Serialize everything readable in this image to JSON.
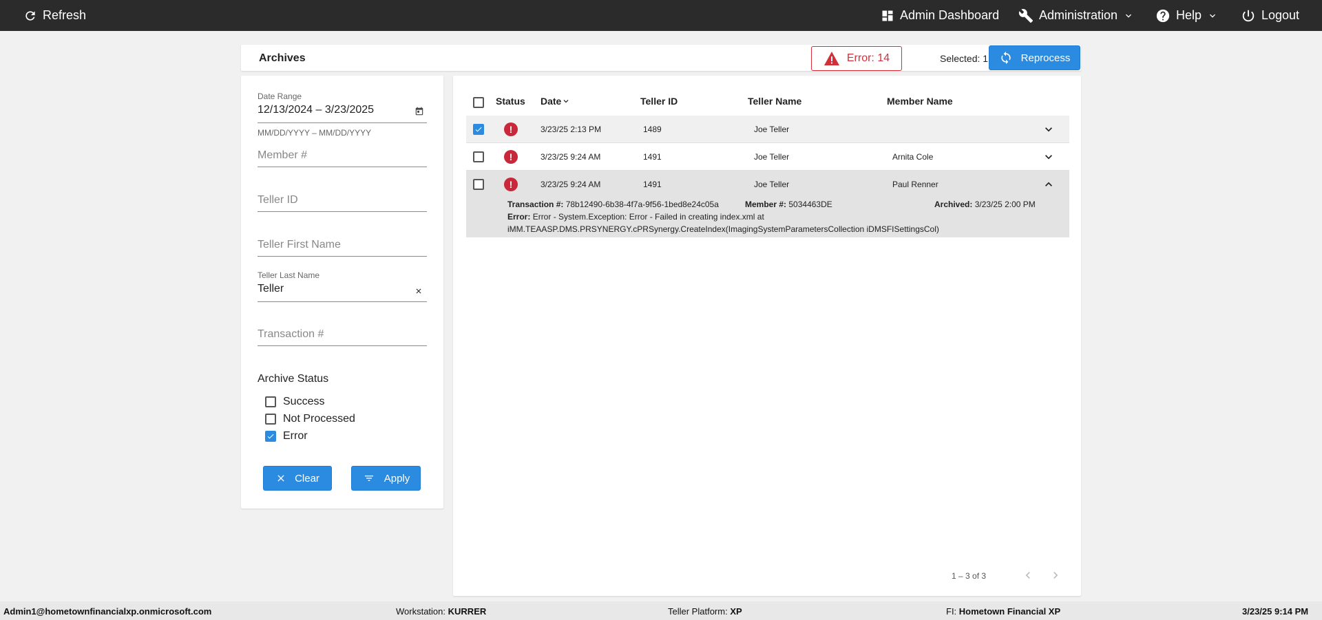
{
  "topbar": {
    "refresh_label": "Refresh",
    "admin_dashboard_label": "Admin Dashboard",
    "administration_label": "Administration",
    "help_label": "Help",
    "logout_label": "Logout"
  },
  "header": {
    "title": "Archives",
    "error_badge": "Error: 14",
    "selected_text": "Selected: 1",
    "reprocess_label": "Reprocess"
  },
  "filters": {
    "date_range_label": "Date Range",
    "date_range_value": "12/13/2024 – 3/23/2025",
    "date_hint": "MM/DD/YYYY – MM/DD/YYYY",
    "member_placeholder": "Member #",
    "teller_id_placeholder": "Teller ID",
    "teller_first_placeholder": "Teller First Name",
    "teller_last_label": "Teller Last Name",
    "teller_last_value": "Teller",
    "transaction_placeholder": "Transaction #",
    "archive_status_title": "Archive Status",
    "status_options": [
      {
        "label": "Success",
        "checked": false
      },
      {
        "label": "Not Processed",
        "checked": false
      },
      {
        "label": "Error",
        "checked": true
      }
    ],
    "clear_label": "Clear",
    "apply_label": "Apply"
  },
  "table": {
    "columns": [
      "Status",
      "Date",
      "Teller ID",
      "Teller Name",
      "Member Name"
    ],
    "rows": [
      {
        "checked": true,
        "date": "3/23/25 2:13 PM",
        "teller_id": "1489",
        "teller_name": "Joe Teller",
        "member_name": ""
      },
      {
        "checked": false,
        "date": "3/23/25 9:24 AM",
        "teller_id": "1491",
        "teller_name": "Joe Teller",
        "member_name": "Arnita Cole"
      },
      {
        "checked": false,
        "date": "3/23/25 9:24 AM",
        "teller_id": "1491",
        "teller_name": "Joe Teller",
        "member_name": "Paul Renner"
      }
    ],
    "detail": {
      "transaction_label": "Transaction #:",
      "transaction_value": "78b12490-6b38-4f7a-9f56-1bed8e24c05a",
      "member_label": "Member #:",
      "member_value": "5034463DE",
      "archived_label": "Archived:",
      "archived_value": "3/23/25 2:00 PM",
      "error_label": "Error:",
      "error_line1": "Error - System.Exception: Error - Failed in creating index.xml at",
      "error_line2": "iMM.TEAASP.DMS.PRSYNERGY.cPRSynergy.CreateIndex(ImagingSystemParametersCollection iDMSFISettingsCol)"
    },
    "pager_text": "1 – 3 of 3"
  },
  "footer": {
    "user": "Admin1@hometownfinancialxp.onmicrosoft.com",
    "workstation_label": "Workstation:",
    "workstation_value": "KURRER",
    "platform_label": "Teller Platform:",
    "platform_value": "XP",
    "fi_label": "FI:",
    "fi_value": "Hometown Financial XP",
    "datetime": "3/23/25 9:14 PM"
  },
  "colors": {
    "topbar": "#2b2b2b",
    "accent": "#2b8be0",
    "error": "#d32f3a"
  }
}
